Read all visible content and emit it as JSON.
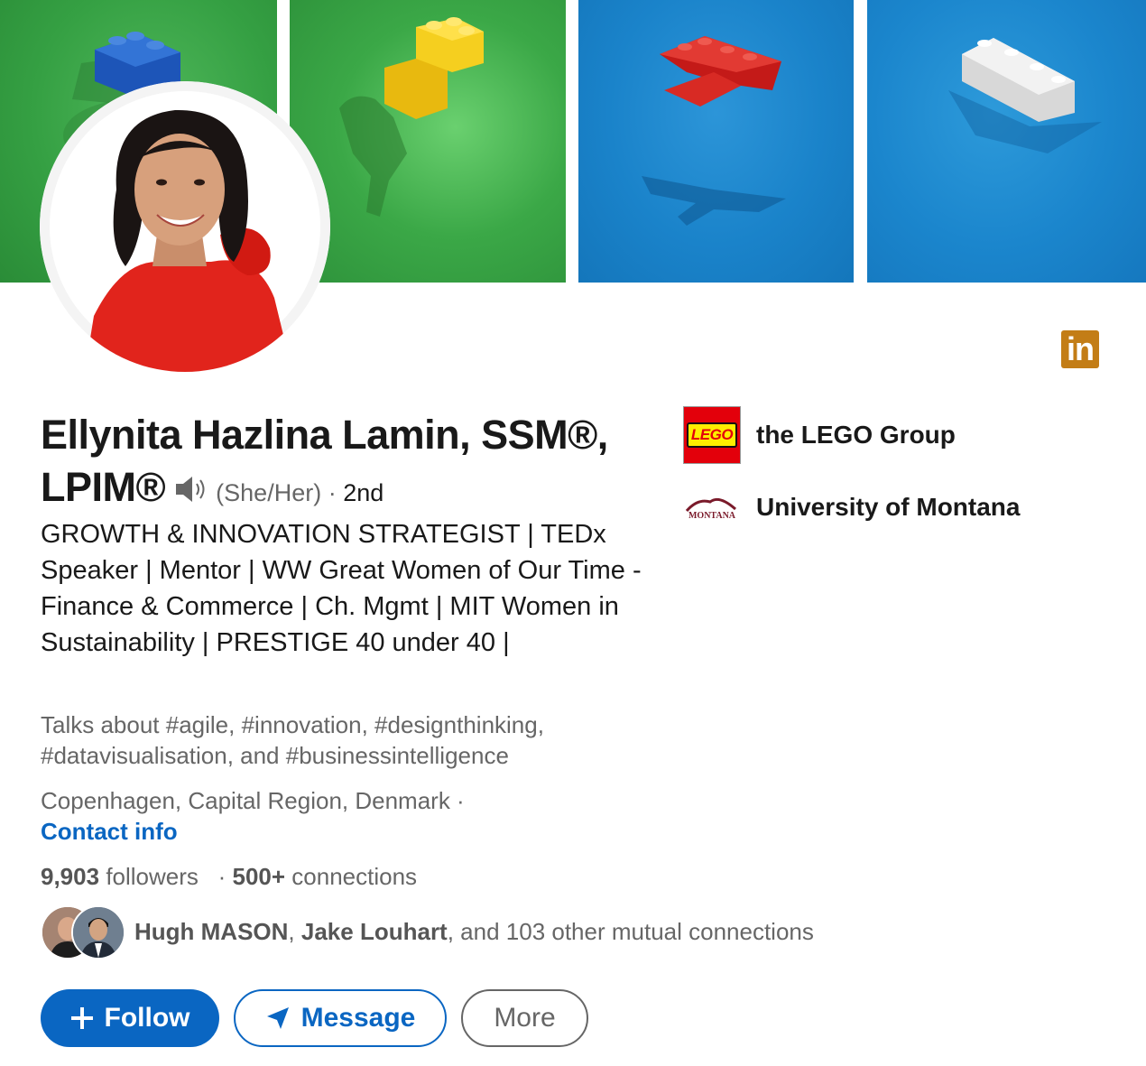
{
  "profile": {
    "name": "Ellynita Hazlina Lamin, SSM®, LPIM®",
    "pronouns": "(She/Her)",
    "degree_separator": "·",
    "degree": "2nd",
    "headline": "GROWTH & INNOVATION STRATEGIST | TEDx Speaker | Mentor | WW Great Women of Our Time - Finance & Commerce | Ch. Mgmt | MIT Women in Sustainability | PRESTIGE 40 under 40 |",
    "talks_about": "Talks about #agile, #innovation, #designthinking, #datavisualisation, and #businessintelligence",
    "location": "Copenhagen, Capital Region, Denmark ·",
    "contact_info_label": "Contact info",
    "followers_count": "9,903",
    "followers_label": "followers",
    "stats_separator": "·",
    "connections_count": "500+",
    "connections_label": "connections"
  },
  "mutual": {
    "name1": "Hugh MASON",
    "separator": ",",
    "name2": "Jake Louhart",
    "rest": ", and 103 other mutual connections"
  },
  "actions": {
    "follow": "Follow",
    "message": "Message",
    "more": "More"
  },
  "organizations": [
    {
      "name": "the LEGO Group",
      "logo_text": "LEGO"
    },
    {
      "name": "University of Montana",
      "logo_text": "MONTANA"
    }
  ],
  "badge": {
    "text": "in"
  },
  "colors": {
    "primary": "#0a66c2",
    "badge": "#c37d16",
    "muted_text": "#666666",
    "body_text": "#191919"
  }
}
